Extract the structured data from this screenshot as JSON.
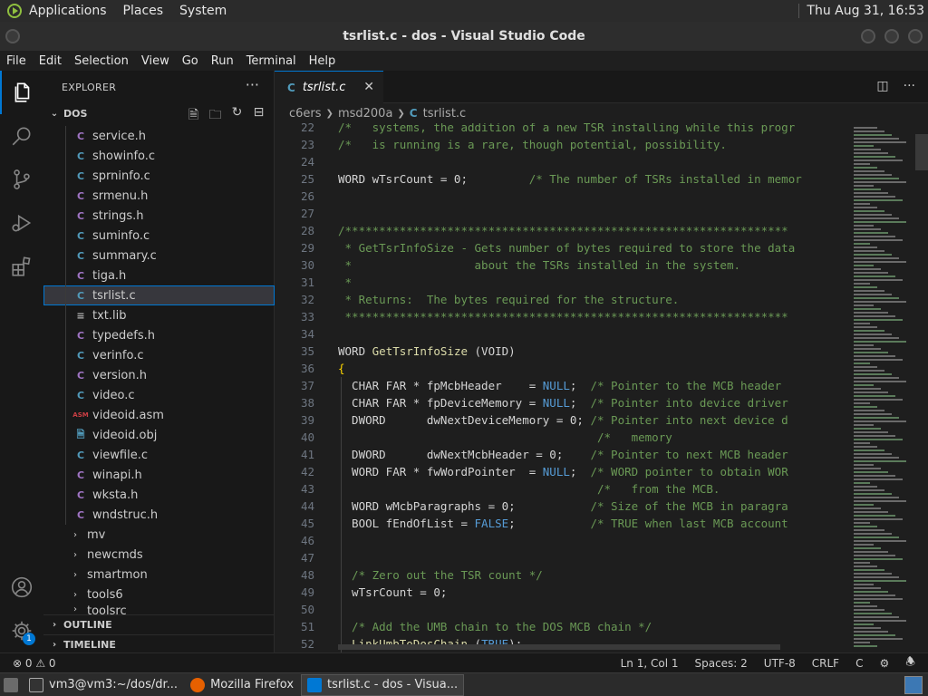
{
  "panel": {
    "menus": [
      "Applications",
      "Places",
      "System"
    ],
    "clock": "Thu Aug 31, 16:53"
  },
  "window": {
    "title": "tsrlist.c - dos - Visual Studio Code"
  },
  "menubar": [
    "File",
    "Edit",
    "Selection",
    "View",
    "Go",
    "Run",
    "Terminal",
    "Help"
  ],
  "activity": {
    "accounts_badge": "1"
  },
  "sidebar": {
    "title": "EXPLORER",
    "more": "···",
    "folder": "DOS",
    "files": [
      {
        "name": "service.h",
        "type": "h"
      },
      {
        "name": "showinfo.c",
        "type": "c"
      },
      {
        "name": "sprninfo.c",
        "type": "c"
      },
      {
        "name": "srmenu.h",
        "type": "h"
      },
      {
        "name": "strings.h",
        "type": "h"
      },
      {
        "name": "suminfo.c",
        "type": "c"
      },
      {
        "name": "summary.c",
        "type": "c"
      },
      {
        "name": "tiga.h",
        "type": "h"
      },
      {
        "name": "tsrlist.c",
        "type": "c",
        "selected": true
      },
      {
        "name": "txt.lib",
        "type": "lib"
      },
      {
        "name": "typedefs.h",
        "type": "h"
      },
      {
        "name": "verinfo.c",
        "type": "c"
      },
      {
        "name": "version.h",
        "type": "h"
      },
      {
        "name": "video.c",
        "type": "c"
      },
      {
        "name": "videoid.asm",
        "type": "asm"
      },
      {
        "name": "videoid.obj",
        "type": "obj"
      },
      {
        "name": "viewfile.c",
        "type": "c"
      },
      {
        "name": "winapi.h",
        "type": "h"
      },
      {
        "name": "wksta.h",
        "type": "h"
      },
      {
        "name": "wndstruc.h",
        "type": "h"
      }
    ],
    "folders": [
      "mv",
      "newcmds",
      "smartmon",
      "tools6",
      "toolsrc"
    ],
    "outline": "OUTLINE",
    "timeline": "TIMELINE"
  },
  "editor": {
    "tab_label": "tsrlist.c",
    "breadcrumb": [
      "c6ers",
      "msd200a",
      "tsrlist.c"
    ],
    "lines": [
      {
        "n": "22",
        "t": "/*   systems, the addition of a new TSR installing while this progr",
        "k": "cm"
      },
      {
        "n": "23",
        "t": "/*   is running is a rare, though potential, possibility.",
        "k": "cm"
      },
      {
        "n": "24",
        "t": "",
        "k": ""
      },
      {
        "n": "25",
        "t": "WORD wTsrCount = 0;",
        "k": "plain",
        "c": "         /* The number of TSRs installed in memor"
      },
      {
        "n": "26",
        "t": "",
        "k": ""
      },
      {
        "n": "27",
        "t": "",
        "k": ""
      },
      {
        "n": "28",
        "t": "/*****************************************************************",
        "k": "cm"
      },
      {
        "n": "29",
        "t": " * GetTsrInfoSize - Gets number of bytes required to store the data",
        "k": "cm"
      },
      {
        "n": "30",
        "t": " *                  about the TSRs installed in the system.",
        "k": "cm"
      },
      {
        "n": "31",
        "t": " *",
        "k": "cm"
      },
      {
        "n": "32",
        "t": " * Returns:  The bytes required for the structure.",
        "k": "cm"
      },
      {
        "n": "33",
        "t": " *****************************************************************",
        "k": "cm"
      },
      {
        "n": "34",
        "t": "",
        "k": ""
      },
      {
        "n": "35",
        "t": "WORD GetTsrInfoSize (VOID)",
        "k": "fndecl"
      },
      {
        "n": "36",
        "t": "{",
        "k": "brace"
      },
      {
        "n": "37",
        "t": "  CHAR FAR * fpMcbHeader    = NULL;",
        "k": "null",
        "c": "  /* Pointer to the MCB header"
      },
      {
        "n": "38",
        "t": "  CHAR FAR * fpDeviceMemory = NULL;",
        "k": "null",
        "c": "  /* Pointer into device driver"
      },
      {
        "n": "39",
        "t": "  DWORD      dwNextDeviceMemory = 0;",
        "k": "plain",
        "c": " /* Pointer into next device d"
      },
      {
        "n": "40",
        "t": "",
        "k": "cmonly",
        "c": "                                      /*   memory"
      },
      {
        "n": "41",
        "t": "  DWORD      dwNextMcbHeader = 0;",
        "k": "plain",
        "c": "    /* Pointer to next MCB header"
      },
      {
        "n": "42",
        "t": "  WORD FAR * fwWordPointer  = NULL;",
        "k": "null",
        "c": "  /* WORD pointer to obtain WOR"
      },
      {
        "n": "43",
        "t": "",
        "k": "cmonly",
        "c": "                                      /*   from the MCB."
      },
      {
        "n": "44",
        "t": "  WORD wMcbParagraphs = 0;",
        "k": "plain",
        "c": "           /* Size of the MCB in paragra"
      },
      {
        "n": "45",
        "t": "  BOOL fEndOfList = FALSE;",
        "k": "false",
        "c": "           /* TRUE when last MCB account"
      },
      {
        "n": "46",
        "t": "",
        "k": ""
      },
      {
        "n": "47",
        "t": "",
        "k": ""
      },
      {
        "n": "48",
        "t": "  /* Zero out the TSR count */",
        "k": "cm"
      },
      {
        "n": "49",
        "t": "  wTsrCount = 0;",
        "k": "plain"
      },
      {
        "n": "50",
        "t": "",
        "k": ""
      },
      {
        "n": "51",
        "t": "  /* Add the UMB chain to the DOS MCB chain */",
        "k": "cm"
      },
      {
        "n": "52",
        "t": "  LinkUmbToDosChain (TRUE);",
        "k": "call"
      }
    ]
  },
  "statusbar": {
    "problems": "⊗ 0 ⚠ 0",
    "position": "Ln 1, Col 1",
    "spaces": "Spaces: 2",
    "encoding": "UTF-8",
    "eol": "CRLF",
    "language": "C"
  },
  "taskbar": {
    "tasks": [
      "vm3@vm3:~/dos/dr...",
      "Mozilla Firefox",
      "tsrlist.c - dos - Visua..."
    ]
  }
}
